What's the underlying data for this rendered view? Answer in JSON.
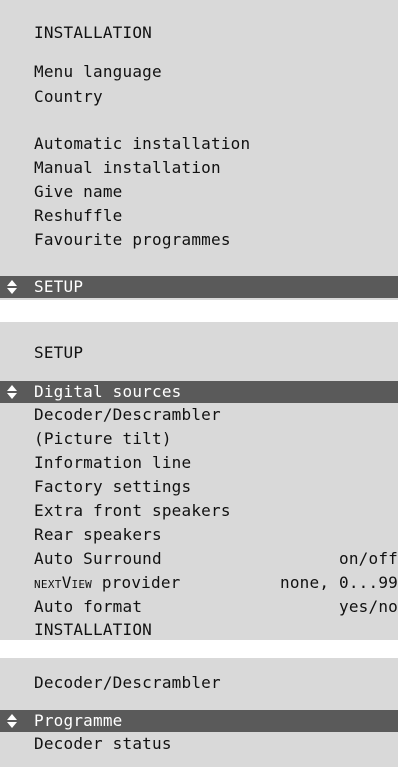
{
  "installation_menu": {
    "title": "INSTALLATION",
    "items": [
      "Menu language",
      "Country",
      "Automatic installation",
      "Manual installation",
      "Give name",
      "Reshuffle",
      "Favourite programmes"
    ],
    "highlighted": "SETUP"
  },
  "setup_menu": {
    "title": "SETUP",
    "highlighted": "Digital sources",
    "items": [
      {
        "label": "Decoder/Descrambler",
        "value": ""
      },
      {
        "label": "(Picture tilt)",
        "value": ""
      },
      {
        "label": "Information line",
        "value": ""
      },
      {
        "label": "Factory settings",
        "value": ""
      },
      {
        "label": "Extra front speakers",
        "value": ""
      },
      {
        "label": "Rear speakers",
        "value": ""
      },
      {
        "label": "Auto Surround",
        "value": "on/off"
      },
      {
        "label_prefix": "NEXT",
        "label_smallcaps": "View",
        "label_suffix": " provider",
        "value": "none, 0...99"
      },
      {
        "label": "Auto format",
        "value": "yes/no"
      },
      {
        "label": "INSTALLATION",
        "value": ""
      }
    ]
  },
  "decoder_menu": {
    "title": "Decoder/Descrambler",
    "highlighted": "Programme",
    "items": [
      "Decoder status"
    ]
  },
  "colors": {
    "panel_bg": "#d9d9d9",
    "highlight_bg": "#5a5a5a",
    "highlight_text": "#ffffff",
    "text": "#111111"
  },
  "icons": {
    "selector": "up-down-arrows-icon"
  }
}
